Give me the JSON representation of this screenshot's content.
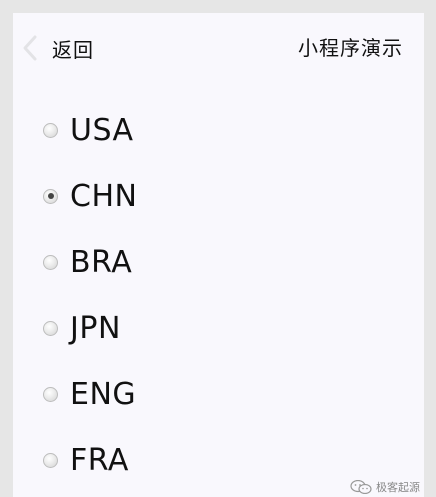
{
  "nav": {
    "back_label": "返回",
    "title": "小程序演示",
    "back_icon": "chevron-left-icon"
  },
  "options": [
    {
      "label": "USA",
      "checked": false
    },
    {
      "label": "CHN",
      "checked": true
    },
    {
      "label": "BRA",
      "checked": false
    },
    {
      "label": "JPN",
      "checked": false
    },
    {
      "label": "ENG",
      "checked": false
    },
    {
      "label": "FRA",
      "checked": false
    }
  ],
  "watermark": {
    "text": "极客起源",
    "icon": "wechat-icon"
  },
  "colors": {
    "background": "#f9f8fd",
    "outer": "#e6e6e6",
    "text": "#111111",
    "radio_dot": "#444444"
  }
}
